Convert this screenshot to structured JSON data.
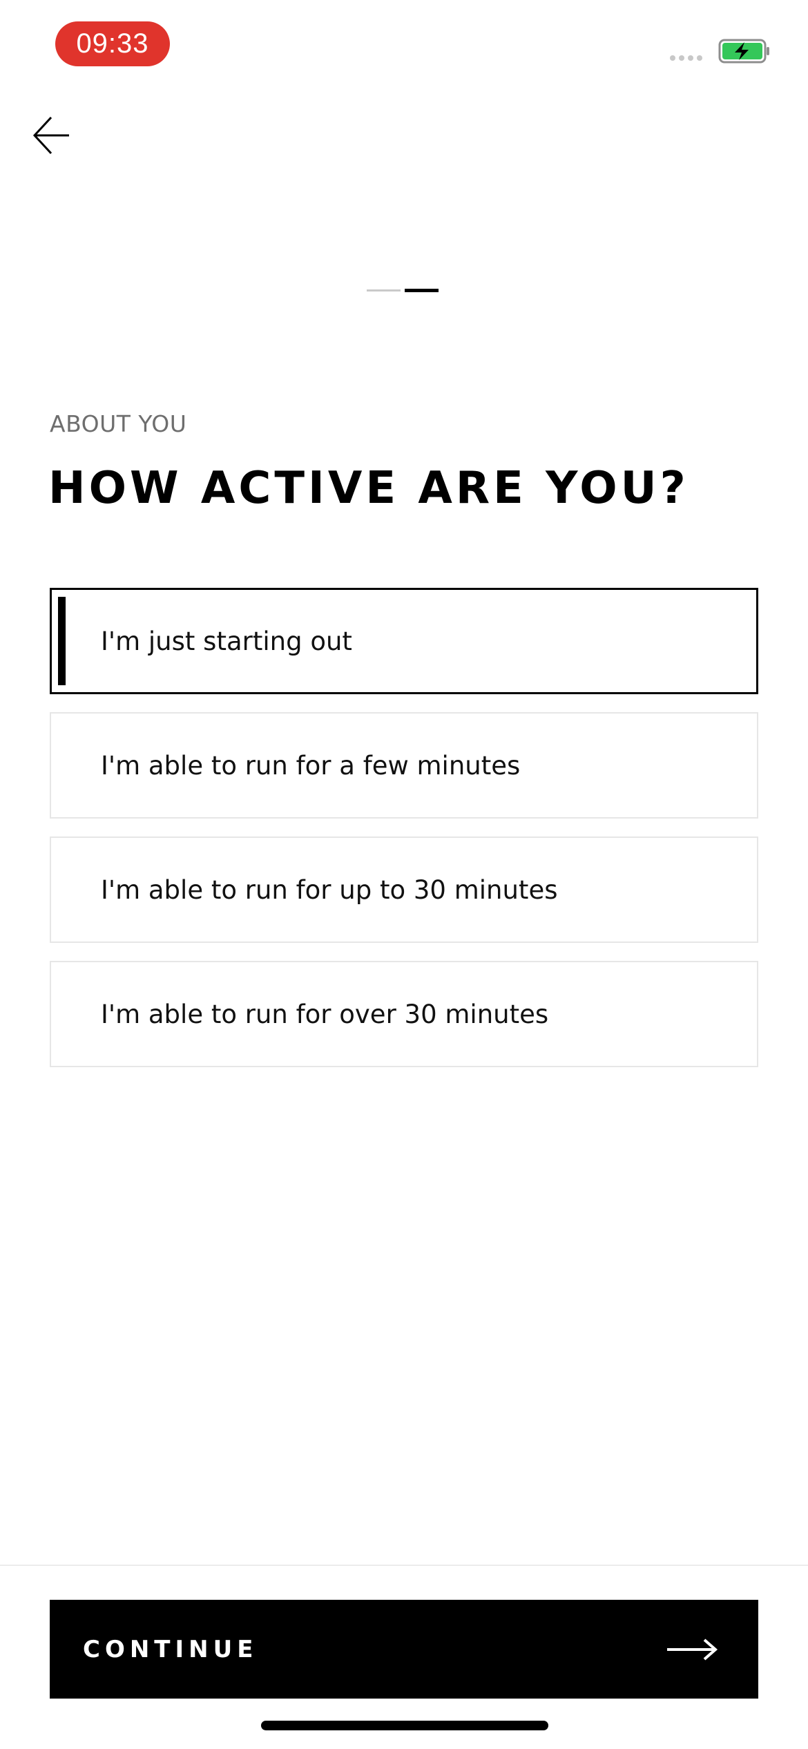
{
  "status_bar": {
    "time": "09:33",
    "battery_color": "#34c759",
    "time_pill_color": "#e0342c"
  },
  "header": {
    "back_icon": "arrow-left-icon",
    "progress": {
      "current_step": 2,
      "total_steps": 2
    }
  },
  "main": {
    "eyebrow": "ABOUT YOU",
    "title": "HOW ACTIVE ARE YOU?",
    "options": [
      {
        "label": "I'm just starting out",
        "selected": true
      },
      {
        "label": "I'm able to run for a few minutes",
        "selected": false
      },
      {
        "label": "I'm able to run for up to 30 minutes",
        "selected": false
      },
      {
        "label": "I'm able to run for over 30 minutes",
        "selected": false
      }
    ]
  },
  "footer": {
    "continue_label": "CONTINUE",
    "continue_icon": "arrow-right-icon"
  }
}
